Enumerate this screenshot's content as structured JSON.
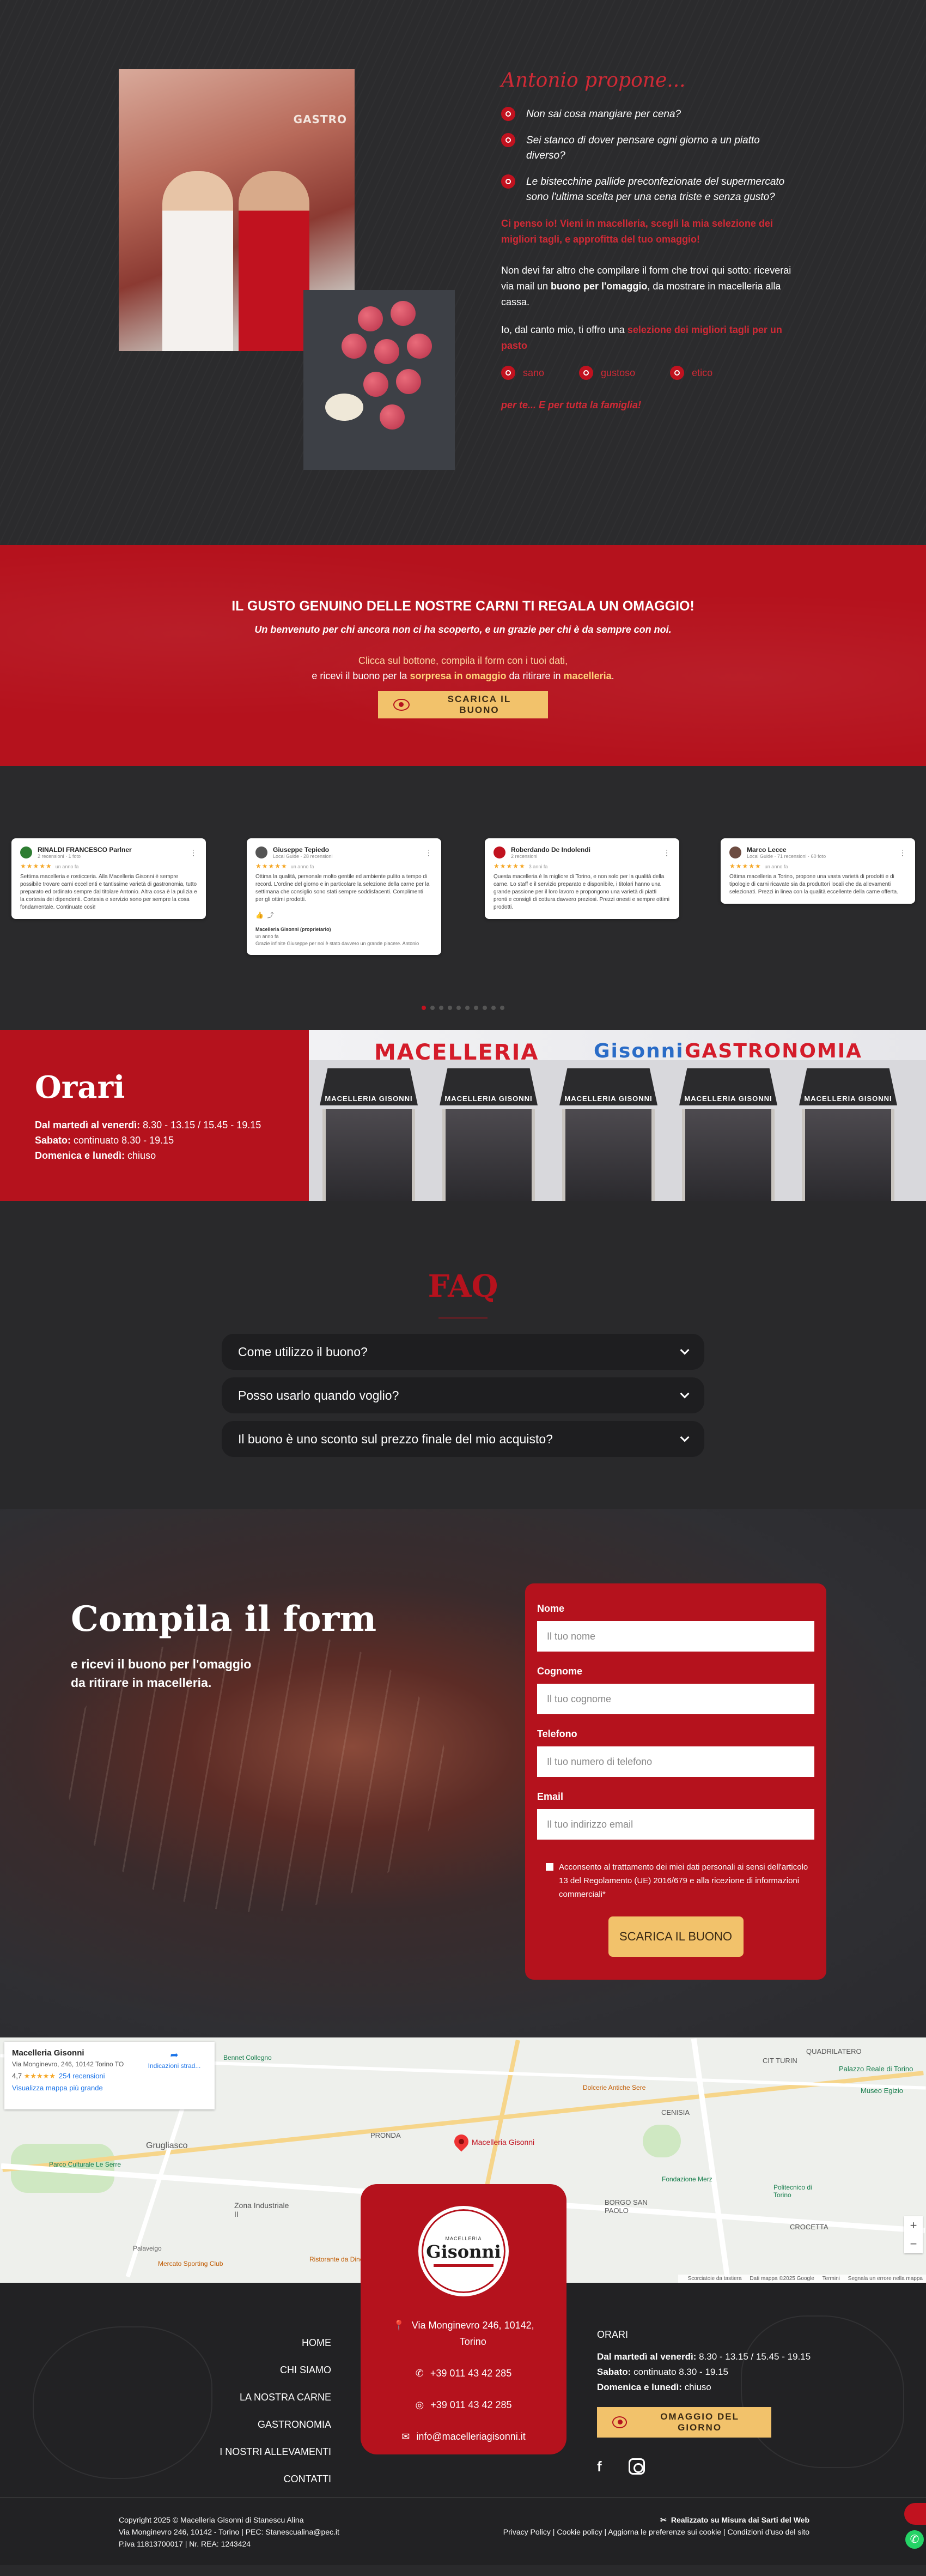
{
  "intro": {
    "title": "Antonio propone...",
    "shop_sign": "GASTRO",
    "bullets": [
      "Non sai cosa mangiare per cena?",
      "Sei stanco di dover pensare ogni giorno a un piatto diverso?",
      "Le bistecchine pallide preconfezionate del supermercato sono l'ultima scelta per una cena triste e senza gusto?"
    ],
    "highlight": "Ci penso io! Vieni in macelleria, scegli la mia selezione dei migliori tagli, e approfitta del tuo omaggio!",
    "p1_a": "Non devi far altro che compilare il form che trovi qui sotto: riceverai via mail un ",
    "p1_b": "buono per l'omaggio",
    "p1_c": ", da mostrare in macelleria alla cassa.",
    "p2_a": "Io, dal canto mio, ti offro una ",
    "p2_b": "selezione dei migliori tagli per un pasto",
    "tags": [
      "sano",
      "gustoso",
      "etico"
    ],
    "final": "per te... E per tutta la famiglia!"
  },
  "gift": {
    "heading": "IL GUSTO GENUINO DELLE NOSTRE CARNI TI REGALA UN OMAGGIO!",
    "subheading": "Un benvenuto per chi ancora non ci ha scoperto, e un grazie per chi è da sempre con noi.",
    "line1": "Clicca sul bottone, compila il form con i tuoi dati,",
    "line2_a": "e ricevi il buono per la ",
    "line2_b": "sorpresa in omaggio",
    "line2_c": " da ritirare in ",
    "line2_d": "macelleria",
    "line2_e": ".",
    "button": "SCARICA IL BUONO"
  },
  "reviews": [
    {
      "name": "RINALDI FRANCESCO Parlner",
      "meta": "2 recensioni · 1 foto",
      "when": "un anno fa",
      "text": "Settima macelleria e rosticceria. Alla Macelleria Gisonni è sempre possibile trovare carni eccellenti e tantissime varietà di gastronomia, tutto preparato ed ordinato sempre dal titolare Antonio. Altra cosa è la pulizia e la cortesia dei dipendenti. Cortesia e servizio sono per sempre la cosa fondamentale. Continuate così!",
      "avatar_color": "#2e7d32"
    },
    {
      "name": "Giuseppe Tepiedo",
      "meta": "Local Guide · 28 recensioni",
      "when": "un anno fa",
      "text": "Ottima la qualità, personale molto gentile ed ambiente pulito a tempo di record. L'ordine del giorno e in particolare la selezione della carne per la settimana che consiglio sono stati sempre soddisfacenti. Complimenti per gli ottimi prodotti.",
      "reply_name": "Macelleria Gisonni (proprietario)",
      "reply_when": "un anno fa",
      "reply_text": "Grazie infinite Giuseppe per noi è stato davvero un grande piacere. Antonio",
      "avatar_color": "#555555"
    },
    {
      "name": "Roberdando De Indolendi",
      "meta": "2 recensioni",
      "when": "3 anni fa",
      "text": "Questa macelleria è la migliore di Torino, e non solo per la qualità della carne. Lo staff e il servizio preparato e disponibile, i titolari hanno una grande passione per il loro lavoro e propongono una varietà di piatti pronti e consigli di cottura davvero preziosi. Prezzi onesti e sempre ottimi prodotti.",
      "avatar_color": "#c1121f"
    },
    {
      "name": "Marco Lecce",
      "meta": "Local Guide · 71 recensioni · 60 foto",
      "when": "un anno fa",
      "text": "Ottima macelleria a Torino, propone una vasta varietà di prodotti e di tipologie di carni ricavate sia da produttori locali che da allevamenti selezionati. Prezzi in linea con la qualità eccellente della carne offerta.",
      "avatar_color": "#6d4c41"
    }
  ],
  "carousel_dot_count": 10,
  "hours": {
    "title": "Orari",
    "rows": [
      {
        "day": "Dal martedì al venerdì:",
        "time": " 8.30 - 13.15 / 15.45 - 19.15"
      },
      {
        "day": "Sabato:",
        "time": " continuato 8.30 - 19.15"
      },
      {
        "day": "Domenica e lunedì:",
        "time": " chiuso"
      }
    ],
    "storefront": {
      "sign_left": "MACELLERIA",
      "sign_mid": "Gisonni",
      "sign_right": "GASTRONOMIA",
      "awnings": [
        "MACELLERIA GISONNI",
        "MACELLERIA GISONNI",
        "MACELLERIA GISONNI",
        "MACELLERIA GISONNI",
        "MACELLERIA GISONNI"
      ]
    }
  },
  "faq": {
    "title": "FAQ",
    "items": [
      "Come utilizzo il buono?",
      "Posso usarlo quando voglio?",
      "Il buono è uno sconto sul prezzo finale del mio acquisto?"
    ]
  },
  "form": {
    "title": "Compila il form",
    "sub1": "e ricevi il buono per l'omaggio",
    "sub2": "da ritirare in macelleria.",
    "fields": [
      {
        "label": "Nome",
        "placeholder": "Il tuo nome"
      },
      {
        "label": "Cognome",
        "placeholder": "Il tuo cognome"
      },
      {
        "label": "Telefono",
        "placeholder": "Il tuo numero di telefono"
      },
      {
        "label": "Email",
        "placeholder": "Il tuo indirizzo email"
      }
    ],
    "consent": "Acconsento al trattamento dei miei dati personali ai sensi dell'articolo 13 del Regolamento (UE) 2016/679 e alla ricezione di informazioni commerciali*",
    "submit": "SCARICA IL BUONO"
  },
  "map": {
    "card_name": "Macelleria Gisonni",
    "card_addr": "Via Monginevro, 246, 10142 Torino TO",
    "rating": "4,7",
    "stars": "★★★★★",
    "reviews_count": "254 recensioni",
    "bigger_map": "Visualizza mappa più grande",
    "directions": "Indicazioni strad...",
    "pin_label": "Macelleria Gisonni",
    "labels": [
      "Grugliasco",
      "Zona Industriale II",
      "PRONDA",
      "CIT TURIN",
      "QUADRILATERO",
      "CENISIA",
      "BORGO SAN PAOLO",
      "CROCETTA",
      "Palazzo Reale di Torino",
      "Museo Egizio"
    ],
    "pois": [
      "Bennet Collegno",
      "Parco Culturale Le Serre",
      "Ristorante da Dino",
      "Mercato Sporting Club",
      "Fondazione Merz",
      "Palaveigo",
      "Politecnico di Torino",
      "Dolcerie Antiche Sere"
    ],
    "attribution": [
      "Scorciatoie da tastiera",
      "Dati mappa ©2025 Google",
      "Termini",
      "Segnala un errore nella mappa"
    ]
  },
  "footer": {
    "nav": [
      "HOME",
      "CHI SIAMO",
      "LA NOSTRA CARNE",
      "GASTRONOMIA",
      "I NOSTRI ALLEVAMENTI",
      "CONTATTI"
    ],
    "logo_small": "MACELLERIA",
    "logo_big": "Gisonni",
    "address_1": "Via Monginevro 246, 10142,",
    "address_2": "Torino",
    "phone": "+39 011 43 42 285",
    "whatsapp": "+39 011 43 42 285",
    "email": "info@macelleriagisonni.it",
    "hours_title": "ORARI",
    "hours": [
      {
        "day": "Dal martedì al venerdì:",
        "time": " 8.30 - 13.15 / 15.45 - 19.15"
      },
      {
        "day": "Sabato:",
        "time": " continuato 8.30 - 19.15"
      },
      {
        "day": "Domenica e lunedì:",
        "time": " chiuso"
      }
    ],
    "button": "OMAGGIO DEL GIORNO",
    "facebook": "f"
  },
  "bottom": {
    "copyright": "Copyright 2025 © Macelleria Gisonni di Stanescu Alina",
    "address": "Via Monginevro 246, 10142 - Torino | PEC: Stanescualina@pec.it",
    "vat": "P.iva 11813700017 | Nr. REA: 1243424",
    "made": "Realizzato su Misura dai Sarti del Web",
    "links": [
      "Privacy Policy",
      "Cookie policy",
      "Aggiorna le preferenze sui cookie",
      "Condizioni d'uso del sito"
    ]
  },
  "colors": {
    "brand_red": "#b5121d",
    "accent_red": "#d12a36",
    "gold": "#f2c26b",
    "dark_bg": "#2a2a2c"
  }
}
